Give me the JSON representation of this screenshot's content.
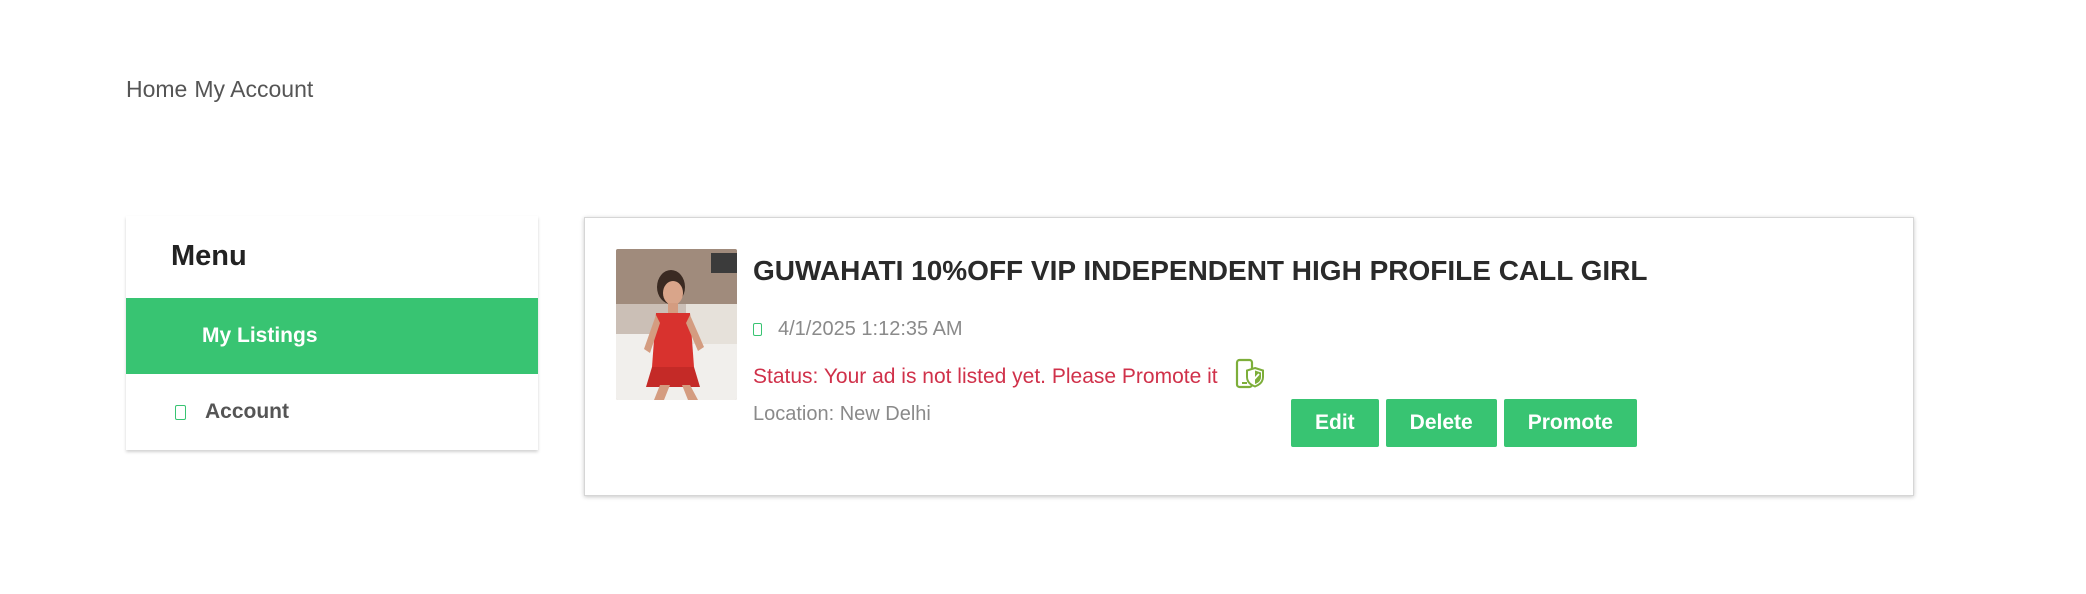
{
  "breadcrumb": {
    "home": "Home",
    "current": "My Account"
  },
  "sidebar": {
    "title": "Menu",
    "items": [
      {
        "label": "My Listings",
        "active": true
      },
      {
        "label": "Account",
        "active": false,
        "icon": "account-icon"
      }
    ]
  },
  "listing": {
    "title": "GUWAHATI 10%OFF VIP INDEPENDENT HIGH PROFILE CALL GIRL",
    "date": "4/1/2025 1:12:35 AM",
    "date_icon": "calendar-icon",
    "status": "Status: Your ad is not listed yet. Please Promote it",
    "status_icon": "promote-phone-shield-icon",
    "location": "Location: New Delhi",
    "actions": {
      "edit": "Edit",
      "delete": "Delete",
      "promote": "Promote"
    }
  },
  "colors": {
    "accent": "#38c472",
    "status_text": "#d0314a",
    "muted_text": "#8a8a8a",
    "promote_icon": "#7dae3a"
  }
}
